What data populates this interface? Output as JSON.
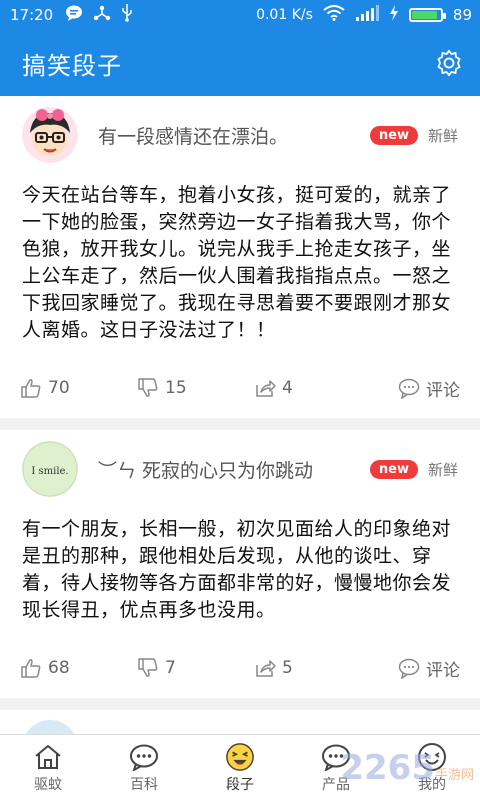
{
  "status_bar": {
    "time": "17:20",
    "net_speed": "0.01 K/s",
    "battery_level": "89",
    "battery_fraction": 0.89,
    "icons": [
      "message-icon",
      "usb-share-icon",
      "usb-icon",
      "wifi-icon",
      "signal-icon",
      "charging-icon"
    ]
  },
  "app_bar": {
    "title": "搞笑段子",
    "settings_icon": "gear-icon"
  },
  "posts": [
    {
      "author": "有一段感情还在漂泊。",
      "badge": "new",
      "tag": "新鲜",
      "content": "今天在站台等车，抱着小女孩，挺可爱的，就亲了一下她的脸蛋，突然旁边一女子指着我大骂，你个色狼，放开我女儿。说完从我手上抢走女孩子，坐上公车走了，然后一伙人围着我指指点点。一怒之下我回家睡觉了。我现在寻思着要不要跟刚才那女人离婚。这日子没法过了！！",
      "likes": "70",
      "dislikes": "15",
      "shares": "4",
      "comment_label": "评论"
    },
    {
      "author": "︶ㄣ 死寂的心只为你跳动",
      "avatar_text": "I smile.",
      "badge": "new",
      "tag": "新鲜",
      "content": "有一个朋友，长相一般，初次见面给人的印象绝对是丑的那种，跟他相处后发现，从他的谈吐、穿着，待人接物等各方面都非常的好，慢慢地你会发现长得丑，优点再多也没用。",
      "likes": "68",
      "dislikes": "7",
      "shares": "5",
      "comment_label": "评论"
    }
  ],
  "bottom_nav": [
    {
      "label": "驱蚊",
      "icon": "home-icon"
    },
    {
      "label": "百科",
      "icon": "chat-bubble-icon"
    },
    {
      "label": "段子",
      "icon": "laugh-face-icon"
    },
    {
      "label": "产品",
      "icon": "chat-bubble-icon"
    },
    {
      "label": "我的",
      "icon": "smile-face-icon"
    }
  ],
  "watermark": {
    "brand": "2265",
    "sub": "手游网"
  }
}
